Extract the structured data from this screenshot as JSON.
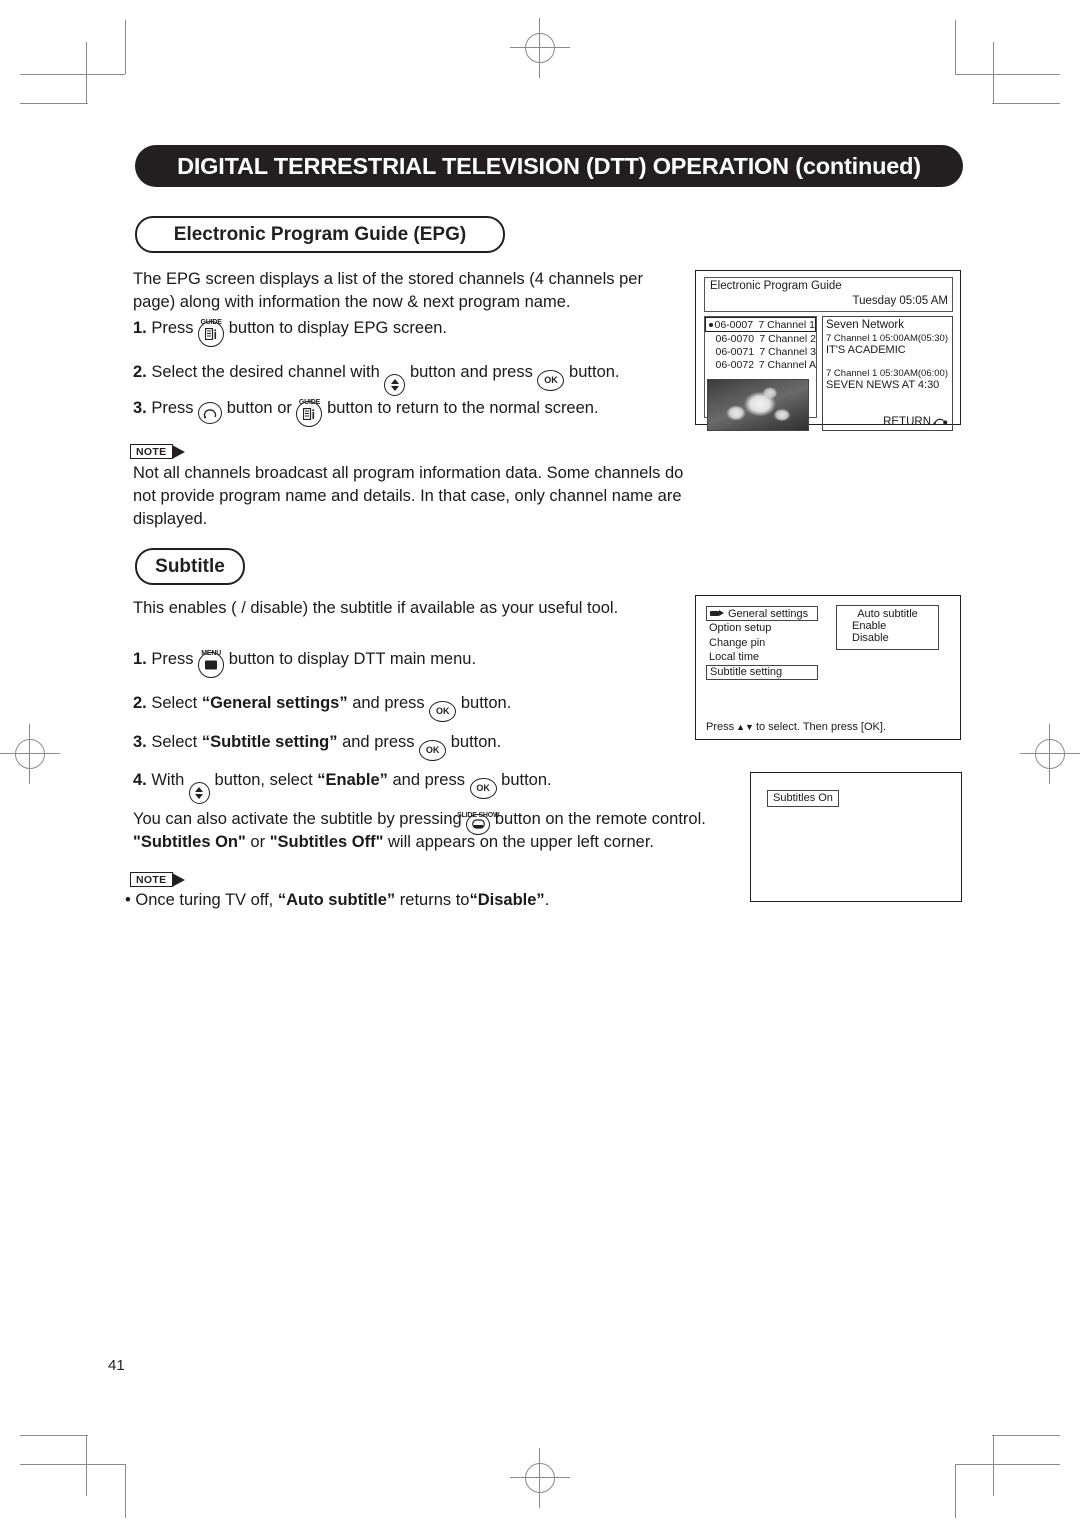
{
  "header": {
    "chapter_title": "DIGITAL TERRESTRIAL TELEVISION (DTT) OPERATION (continued)"
  },
  "sections": {
    "epg": {
      "heading": "Electronic Program Guide (EPG)",
      "intro": "The EPG screen displays a list of the stored channels (4 channels per page) along with information the now & next program name.",
      "steps": [
        {
          "num": "1.",
          "pre": "Press",
          "icon_caption": "GUIDE",
          "post": "button to display EPG screen."
        },
        {
          "num": "2.",
          "pre": "Select the desired channel with",
          "mid": "button and press",
          "post": "button."
        },
        {
          "num": "3.",
          "pre": "Press",
          "mid": "button or",
          "icon_caption": "GUIDE",
          "post": "button to return to the normal screen."
        }
      ],
      "note_label": "NOTE",
      "note_text": "Not all channels broadcast all program information data. Some channels do not provide program name and details.  In that case, only channel name are displayed."
    },
    "subtitle": {
      "heading": "Subtitle",
      "intro": "This enables ( / disable) the subtitle if available as your useful tool.",
      "steps": [
        {
          "num": "1.",
          "pre": "Press",
          "icon_caption": "MENU",
          "post": "button to display DTT main menu."
        },
        {
          "num": "2.",
          "pre": "Select",
          "quoted": "“General settings”",
          "mid": "and press",
          "post": "button."
        },
        {
          "num": "3.",
          "pre": "Select",
          "quoted": "“Subtitle setting”",
          "mid": "and press",
          "post": "button."
        },
        {
          "num": "4.",
          "pre": "With",
          "mid": "button, select",
          "quoted": "“Enable”",
          "mid2": "and press",
          "post": "button."
        }
      ],
      "extra_line1_a": "You can also activate the subtitle by pressing",
      "extra_icon_caption": "SLIDE SHOW",
      "extra_line1_b": "button on the remote control.",
      "extra_line2_a": "\"Subtitles On\"",
      "extra_line2_b": "or",
      "extra_line2_c": "\"Subtitles Off\"",
      "extra_line2_d": "will appears on the upper left corner.",
      "note_label": "NOTE",
      "note_bullet": "•",
      "note_text_a": "Once turing TV off,",
      "note_text_b": "“Auto subtitle”",
      "note_text_c": "returns to",
      "note_text_d": "“Disable”",
      "note_text_e": "."
    }
  },
  "illustrations": {
    "epg_screen": {
      "title": "Electronic Program Guide",
      "datetime": "Tuesday 05:05 AM",
      "channels": [
        {
          "number": "06-0007",
          "name": "7 Channel 1",
          "selected": true
        },
        {
          "number": "06-0070",
          "name": "7 Channel 2",
          "selected": false
        },
        {
          "number": "06-0071",
          "name": "7 Channel 3",
          "selected": false
        },
        {
          "number": "06-0072",
          "name": "7 Channel A",
          "selected": false
        }
      ],
      "network": "Seven Network",
      "programs": [
        {
          "time": "7 Channel 1   05:00AM(05:30)",
          "name": "IT'S ACADEMIC"
        },
        {
          "time": "7 Channel 1   05:30AM(06:00)",
          "name": "SEVEN NEWS AT 4:30"
        }
      ],
      "return_label": "RETURN"
    },
    "general_settings_screen": {
      "menu_items": [
        {
          "label": "General settings",
          "boxed": true,
          "has_icon": true
        },
        {
          "label": "Option setup",
          "boxed": false,
          "has_icon": false
        },
        {
          "label": "Change pin",
          "boxed": false,
          "has_icon": false
        },
        {
          "label": "Local time",
          "boxed": false,
          "has_icon": false
        },
        {
          "label": "Subtitle setting",
          "boxed": true,
          "has_icon": false
        }
      ],
      "submenu_title": "Auto subtitle",
      "submenu_items": [
        "Enable",
        "Disable"
      ],
      "footer_pre": "Press",
      "footer_arrows": "▲▼",
      "footer_post": "to select. Then press [OK]."
    },
    "subtitles_screen": {
      "badge": "Subtitles On"
    }
  },
  "footer": {
    "page_number": "41"
  },
  "colors": {
    "banner_background": "#231f20",
    "banner_text": "#ffffff",
    "body_text": "#1a1a1a",
    "crop_mark": "#8a8a8a"
  }
}
